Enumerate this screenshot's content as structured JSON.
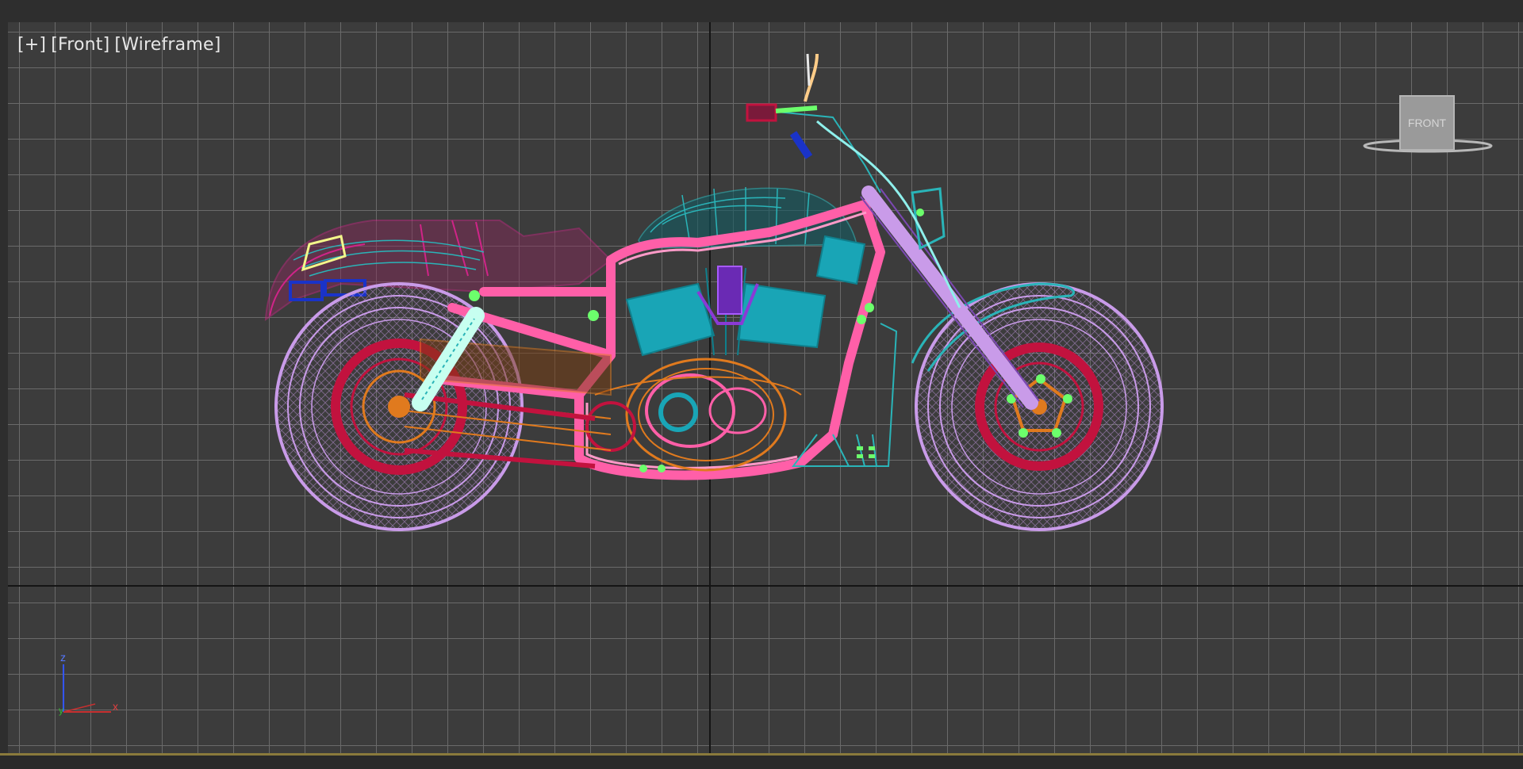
{
  "viewport": {
    "label_plus": "[+]",
    "label_view": "[Front]",
    "label_mode": "[Wireframe]",
    "viewcube_label": "FRONT",
    "axis_labels": {
      "z": "z",
      "y": "y",
      "x": "x"
    }
  },
  "colors": {
    "background": "#3c3c3c",
    "grid": "#6a6a6a",
    "wheel": "#c99be9",
    "frame": "#ff5fa8",
    "engine": "#19a5b6",
    "engine_dark": "#0f7f8c",
    "rim": "#c2123e",
    "chain": "#e07a1e",
    "fender": "#d02488",
    "tank_wire": "#2ab4b8",
    "handlebar": "#ff7ab0",
    "accent_green": "#6cff6c",
    "light_blue": "#1a33c8",
    "yellow": "#f3f78a",
    "cable": "#8ff0ec"
  }
}
